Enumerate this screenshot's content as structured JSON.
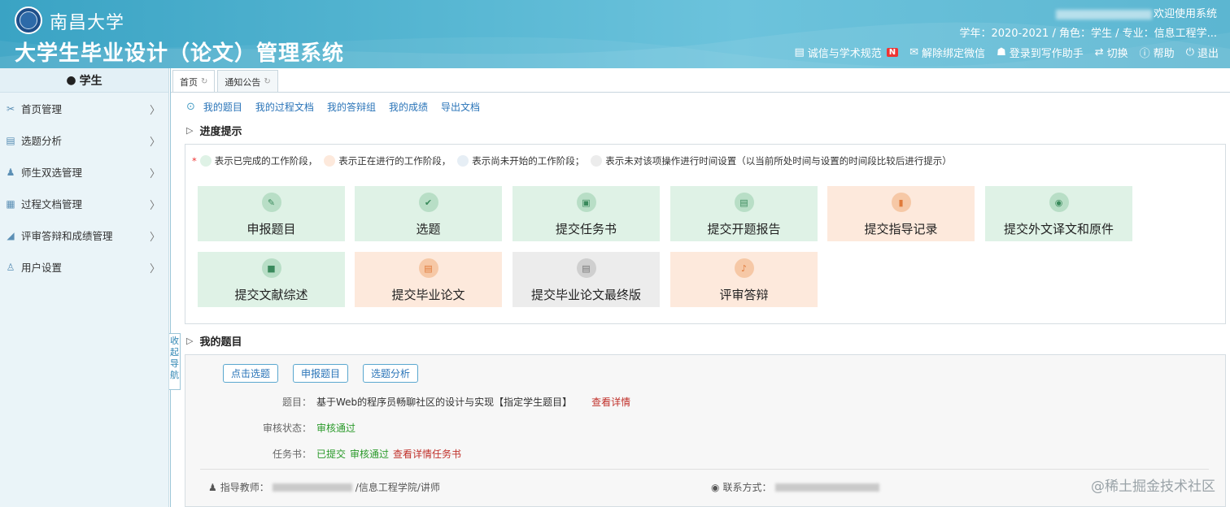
{
  "header": {
    "university": "南昌大学",
    "system_title": "大学生毕业设计（论文）管理系统",
    "welcome_suffix": "欢迎使用系统",
    "role_info": "学年：2020-2021 / 角色：学生 / 专业：信息工程学...",
    "toolbar": [
      {
        "icon": "book-icon",
        "label": "诚信与学术规范",
        "badge": "N"
      },
      {
        "icon": "wechat-icon",
        "label": "解除绑定微信"
      },
      {
        "icon": "user-login-icon",
        "label": "登录到写作助手"
      },
      {
        "icon": "switch-icon",
        "label": "切换"
      },
      {
        "icon": "help-icon",
        "label": "帮助"
      },
      {
        "icon": "power-icon",
        "label": "退出"
      }
    ]
  },
  "sidebar": {
    "title": "学生",
    "items": [
      {
        "icon": "tools-icon",
        "label": "首页管理"
      },
      {
        "icon": "list-icon",
        "label": "选题分析"
      },
      {
        "icon": "users-icon",
        "label": "师生双选管理"
      },
      {
        "icon": "document-icon",
        "label": "过程文档管理"
      },
      {
        "icon": "chart-icon",
        "label": "评审答辩和成绩管理"
      },
      {
        "icon": "user-icon",
        "label": "用户设置"
      }
    ],
    "collapse_label": "收起导航"
  },
  "tabs": [
    {
      "label": "首页",
      "active": true
    },
    {
      "label": "通知公告",
      "active": false
    }
  ],
  "quick_links": [
    "我的题目",
    "我的过程文档",
    "我的答辩组",
    "我的成绩",
    "导出文档"
  ],
  "progress": {
    "section_title": "进度提示",
    "legend": [
      {
        "color": "#dff2e6",
        "text": "表示已完成的工作阶段，"
      },
      {
        "color": "#fde9dc",
        "text": "表示正在进行的工作阶段，"
      },
      {
        "color": "#e6eef5",
        "text": "表示尚未开始的工作阶段；"
      },
      {
        "color": "#ececec",
        "text": "表示未对该项操作进行时间设置（以当前所处时间与设置的时间段比较后进行提示）"
      }
    ],
    "cards": [
      {
        "label": "申报题目",
        "status": "done",
        "icon": "apply-icon"
      },
      {
        "label": "选题",
        "status": "done",
        "icon": "check-icon"
      },
      {
        "label": "提交任务书",
        "status": "done",
        "icon": "clipboard-icon"
      },
      {
        "label": "提交开题报告",
        "status": "done",
        "icon": "report-icon"
      },
      {
        "label": "提交指导记录",
        "status": "in-progress",
        "icon": "file-icon"
      },
      {
        "label": "提交外文译文和原件",
        "status": "done",
        "icon": "translate-icon"
      },
      {
        "label": "提交文献综述",
        "status": "done",
        "icon": "book-icon"
      },
      {
        "label": "提交毕业论文",
        "status": "in-progress",
        "icon": "thesis-icon"
      },
      {
        "label": "提交毕业论文最终版",
        "status": "unset",
        "icon": "final-icon"
      },
      {
        "label": "评审答辩",
        "status": "in-progress",
        "icon": "mic-icon"
      }
    ]
  },
  "my_topic": {
    "section_title": "我的题目",
    "buttons": [
      "点击选题",
      "申报题目",
      "选题分析"
    ],
    "topic_label": "题目：",
    "topic_value": "基于Web的程序员畅聊社区的设计与实现【指定学生题目】",
    "topic_link": "查看详情",
    "review_label": "审核状态：",
    "review_value": "审核通过",
    "task_label": "任务书：",
    "task_submitted": "已提交",
    "task_review": "审核通过",
    "task_link": "查看详情任务书",
    "teacher_label": "指导教师：",
    "teacher_dept": "/信息工程学院/讲师",
    "contact_label": "联系方式："
  },
  "watermark": "@稀土掘金技术社区"
}
